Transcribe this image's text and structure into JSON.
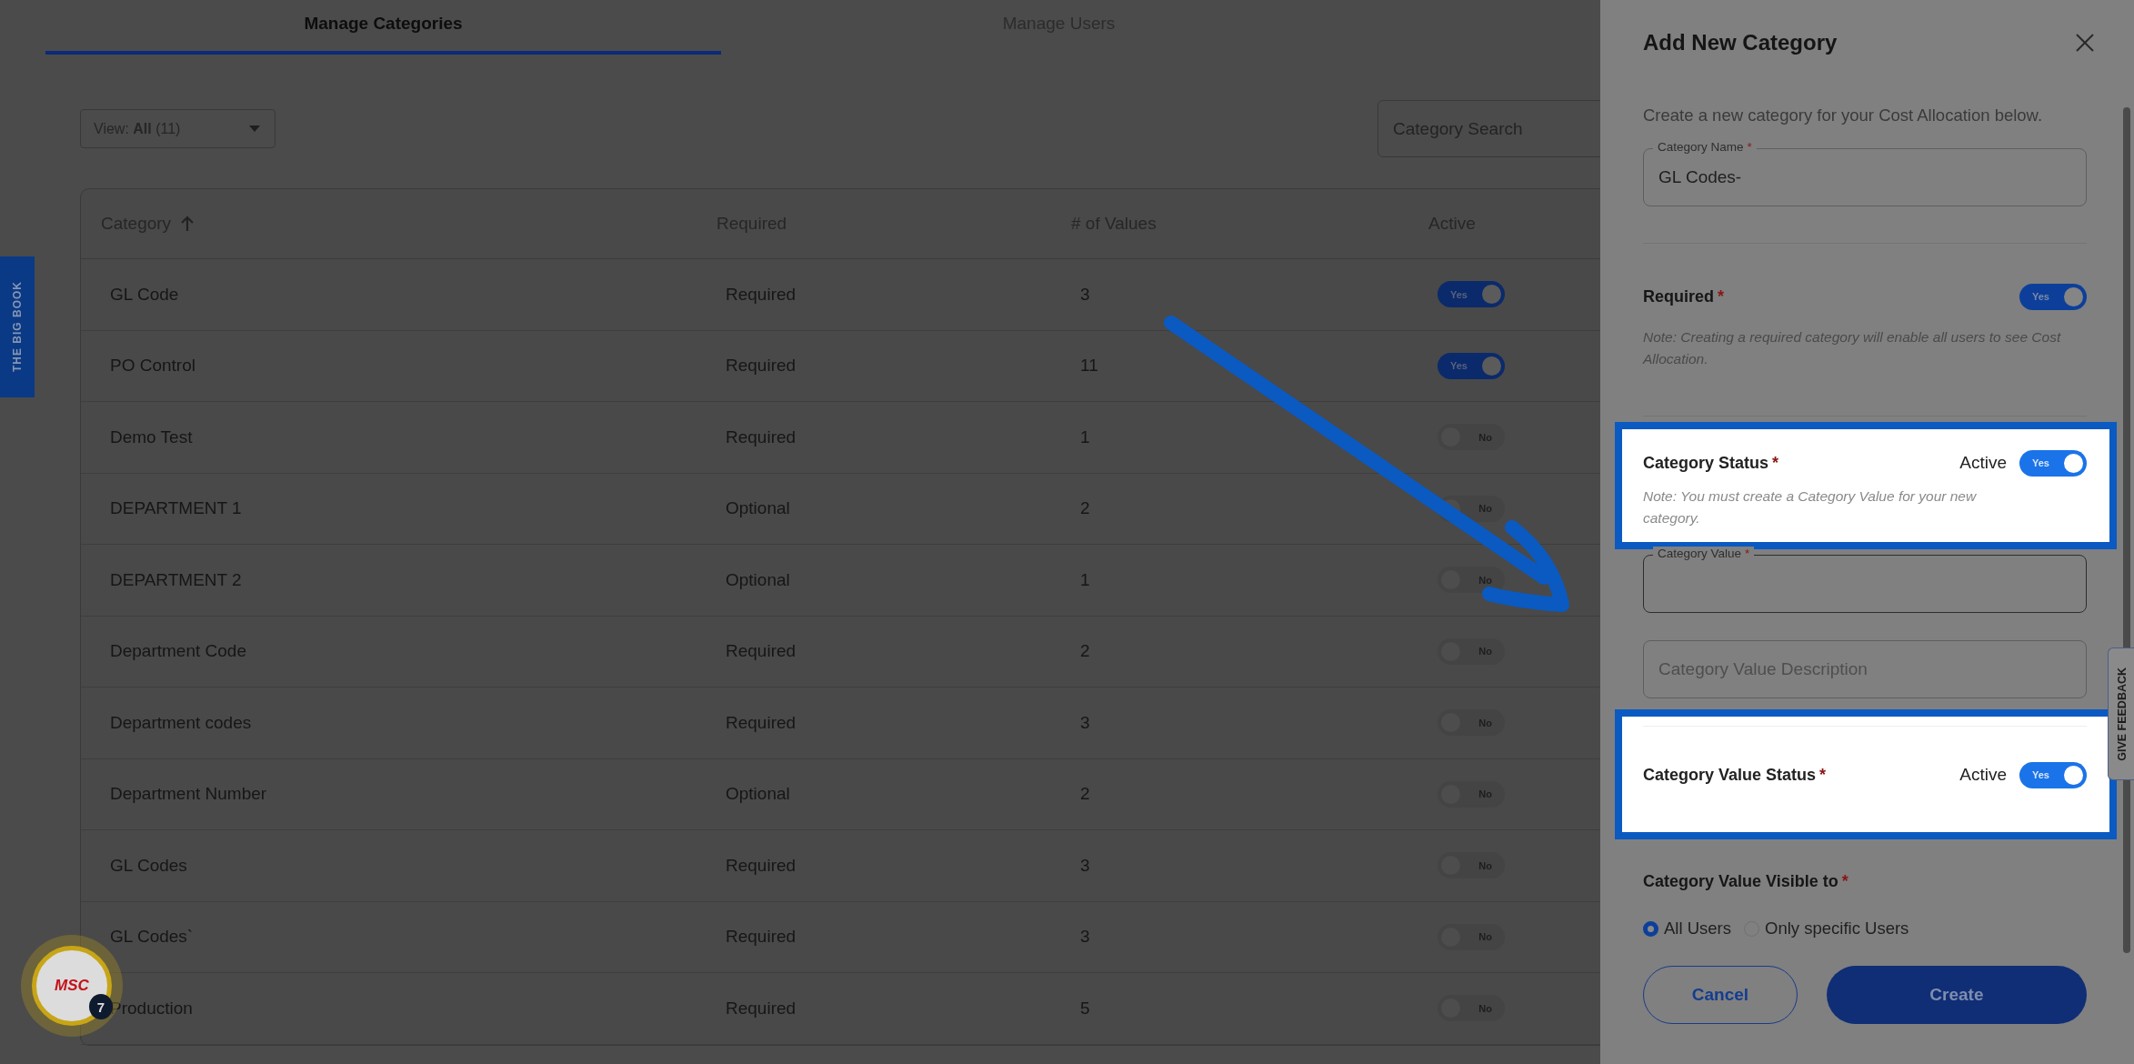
{
  "tabs": [
    {
      "label": "Manage Categories",
      "selected": true
    },
    {
      "label": "Manage Users",
      "selected": false
    }
  ],
  "side_tab": {
    "label": "THE BIG BOOK"
  },
  "view_filter": {
    "value": "View: **All** (11)"
  },
  "search": {
    "placeholder": "Category Search"
  },
  "table": {
    "columns": [
      {
        "label": "Category",
        "sorted": true
      },
      {
        "label": "Required",
        "sorted": false
      },
      {
        "label": "# of Values",
        "sorted": false
      },
      {
        "label": "Active",
        "sorted": false
      }
    ],
    "rows": [
      {
        "category": "GL Code",
        "required": "Required",
        "values": "3",
        "active": true,
        "toggle_label": "Yes"
      },
      {
        "category": "PO Control",
        "required": "Required",
        "values": "11",
        "active": true,
        "toggle_label": "Yes"
      },
      {
        "category": "Demo Test",
        "required": "Required",
        "values": "1",
        "active": false,
        "toggle_label": "No"
      },
      {
        "category": "DEPARTMENT 1",
        "required": "Optional",
        "values": "2",
        "active": false,
        "toggle_label": "No"
      },
      {
        "category": "DEPARTMENT 2",
        "required": "Optional",
        "values": "1",
        "active": false,
        "toggle_label": "No"
      },
      {
        "category": "Department Code",
        "required": "Required",
        "values": "2",
        "active": false,
        "toggle_label": "No"
      },
      {
        "category": "Department codes",
        "required": "Required",
        "values": "3",
        "active": false,
        "toggle_label": "No"
      },
      {
        "category": "Department Number",
        "required": "Optional",
        "values": "2",
        "active": false,
        "toggle_label": "No"
      },
      {
        "category": "GL Codes",
        "required": "Required",
        "values": "3",
        "active": false,
        "toggle_label": "No"
      },
      {
        "category": "GL Codes`",
        "required": "Required",
        "values": "3",
        "active": false,
        "toggle_label": "No"
      },
      {
        "category": "Production",
        "required": "Required",
        "values": "5",
        "active": false,
        "toggle_label": "No"
      }
    ]
  },
  "avatar": {
    "logo": "MSC",
    "badge": "7"
  },
  "drawer": {
    "title": "Add New Category",
    "description": "Create a new category for your Cost Allocation below.",
    "category_name": {
      "label": "Category Name",
      "required_mark": "*",
      "value": "GL Codes-"
    },
    "required": {
      "label": "Required",
      "required_mark": "*",
      "on": true,
      "toggle_label": "Yes",
      "note": "Note: Creating a required category will enable all users to see Cost Allocation.",
      "highlighted": false
    },
    "category_status": {
      "label": "Category Status",
      "required_mark": "*",
      "state_label": "Active",
      "on": true,
      "toggle_label": "Yes",
      "note": "Note: You must create a Category Value for your new category.",
      "highlighted": true
    },
    "category_value": {
      "label": "Category Value",
      "required_mark": "*"
    },
    "category_value_description": {
      "placeholder": "Category Value Description"
    },
    "category_value_status": {
      "label": "Category Value Status",
      "required_mark": "*",
      "state_label": "Active",
      "on": true,
      "toggle_label": "Yes",
      "highlighted": true
    },
    "visible_to": {
      "label": "Category Value Visible to",
      "required_mark": "*",
      "options": [
        {
          "label": "All Users",
          "selected": true
        },
        {
          "label": "Only specific Users",
          "selected": false
        }
      ]
    },
    "buttons": [
      {
        "label": "Cancel",
        "kind": "secondary"
      },
      {
        "label": "Create",
        "kind": "primary"
      }
    ]
  },
  "feedback_tab": {
    "label": "GIVE FEEDBACK"
  }
}
